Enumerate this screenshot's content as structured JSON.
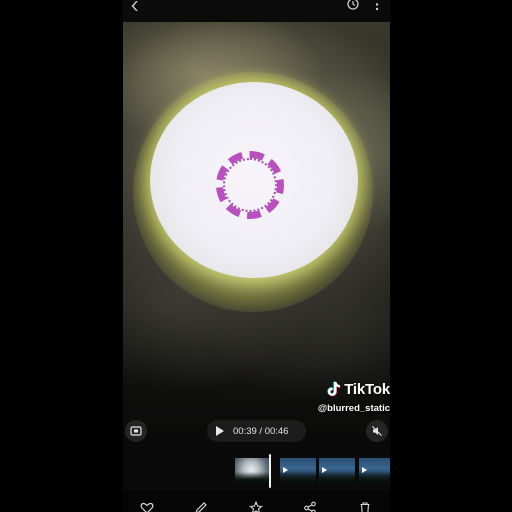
{
  "watermark": {
    "brand": "TikTok",
    "handle": "@blurred_static"
  },
  "player": {
    "time": "00:39 / 00:46"
  },
  "icons": {
    "back": "chevron-left-icon",
    "top_right_1": "rotate-icon",
    "top_right_2": "more-vertical-icon",
    "screenshot": "screen-capture-icon",
    "mute": "mute-icon",
    "play": "play-icon",
    "bottom": [
      "heart-icon",
      "edit-icon",
      "effects-icon",
      "share-icon",
      "delete-icon"
    ]
  },
  "colors": {
    "accent_ring": "#b23fb7",
    "sun_glow": "#d8e07a",
    "background": "#000000"
  }
}
